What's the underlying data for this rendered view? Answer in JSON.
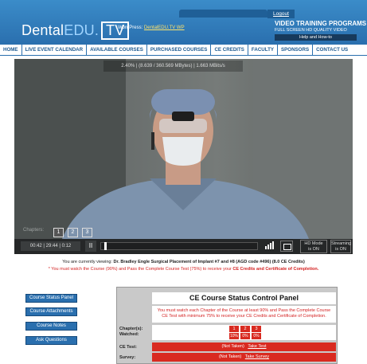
{
  "header": {
    "logo_main": "Dental",
    "logo_edu": "EDU.",
    "logo_tv": "TV",
    "wordpress_label": "WordPress:",
    "wordpress_link": "DentalEDU.TV WP",
    "logout": "Logout",
    "title": "VIDEO TRAINING PROGRAMS",
    "subtitle": "FULL SCREEN HD QUALITY VIDEO",
    "help": "Help and How-to"
  },
  "nav": {
    "items": [
      "HOME",
      "LIVE EVENT CALENDAR",
      "AVAILABLE COURSES",
      "PURCHASED COURSES",
      "CE CREDITS",
      "FACULTY",
      "SPONSORS",
      "CONTACT US"
    ]
  },
  "player": {
    "stats": "2.40% | (8.639 / 360.569 MBytes) | 1.663 MBits/s",
    "chapters_label": "Chapters:",
    "chapters": [
      "1",
      "2",
      "3"
    ],
    "time": "00:42 | 29:44 | 0:12",
    "pause": "II",
    "hd_line1": "HD Mode",
    "hd_line2": "is ON",
    "stream_line1": "Streaming",
    "stream_line2": "is ON"
  },
  "info": {
    "viewing_prefix": "You are currently viewing:",
    "viewing_title": "Dr. Bradley Engle Surgical Placement of Implant #7 and #8 (AGD code #496) (8.0 CE Credits)",
    "warning_prefix": "* You must watch the Course (90%) and Pass the Complete Course Test (75%) to receive your",
    "warning_bold": "CE Credits and Certificate of Completion."
  },
  "side": {
    "buttons": [
      "Course Status Panel",
      "Course Attachments",
      "Course Notes",
      "Ask Questions"
    ]
  },
  "panel": {
    "title": "CE Course Status Control Panel",
    "note_line1": "You must watch each Chapter of the Course at least 90% and Pass the Complete Course",
    "note_line2": "CE Test with minimum 75% to receive your CE Credits and Certificate of Completion.",
    "chapters_label": "Chapter(s):",
    "watched_label": "Watched:",
    "chapter_nums": [
      "1",
      "2",
      "3"
    ],
    "chapter_pcts": [
      "10%",
      "0%",
      "0%"
    ],
    "ce_test_label": "CE Test:",
    "ce_test_status": "(Not Taken)",
    "ce_test_link": "Take Test",
    "survey_label": "Survey:",
    "survey_status": "(Not Taken)",
    "survey_link": "Take Survey"
  },
  "colors": {
    "brand_blue": "#2a6fae",
    "alert_red": "#d92a20",
    "panel_gray": "#c9c9c9"
  }
}
